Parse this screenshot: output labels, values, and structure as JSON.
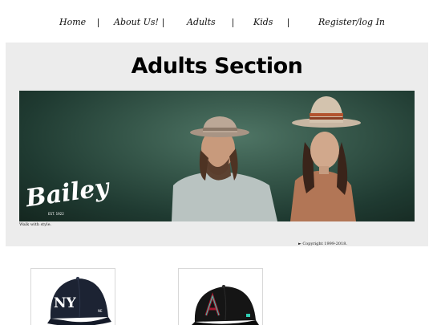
{
  "nav": {
    "items": [
      {
        "label": "Home"
      },
      {
        "label": "About Us!"
      },
      {
        "label": "Adults"
      },
      {
        "label": "Kids"
      },
      {
        "label": "Register/log In"
      }
    ],
    "separator": "|"
  },
  "hero": {
    "title": "Adults Section",
    "banner": {
      "brand_logo_text": "Bailey",
      "brand_logo_subtext": "EST. 1922"
    },
    "tagline": "Walk with style.",
    "copyright": "► Copyright 1999-2018."
  },
  "products": [
    {
      "name": "New York Yankees navy fitted cap",
      "icon": "navy-ny-baseball-cap",
      "color": "#1c2333"
    },
    {
      "name": "Arizona Diamondbacks black fitted cap",
      "icon": "black-a-baseball-cap",
      "color": "#151515"
    }
  ],
  "colors": {
    "panel_bg": "#ececec",
    "banner_bg": "#2f4f43",
    "page_bg": "#ffffff"
  }
}
